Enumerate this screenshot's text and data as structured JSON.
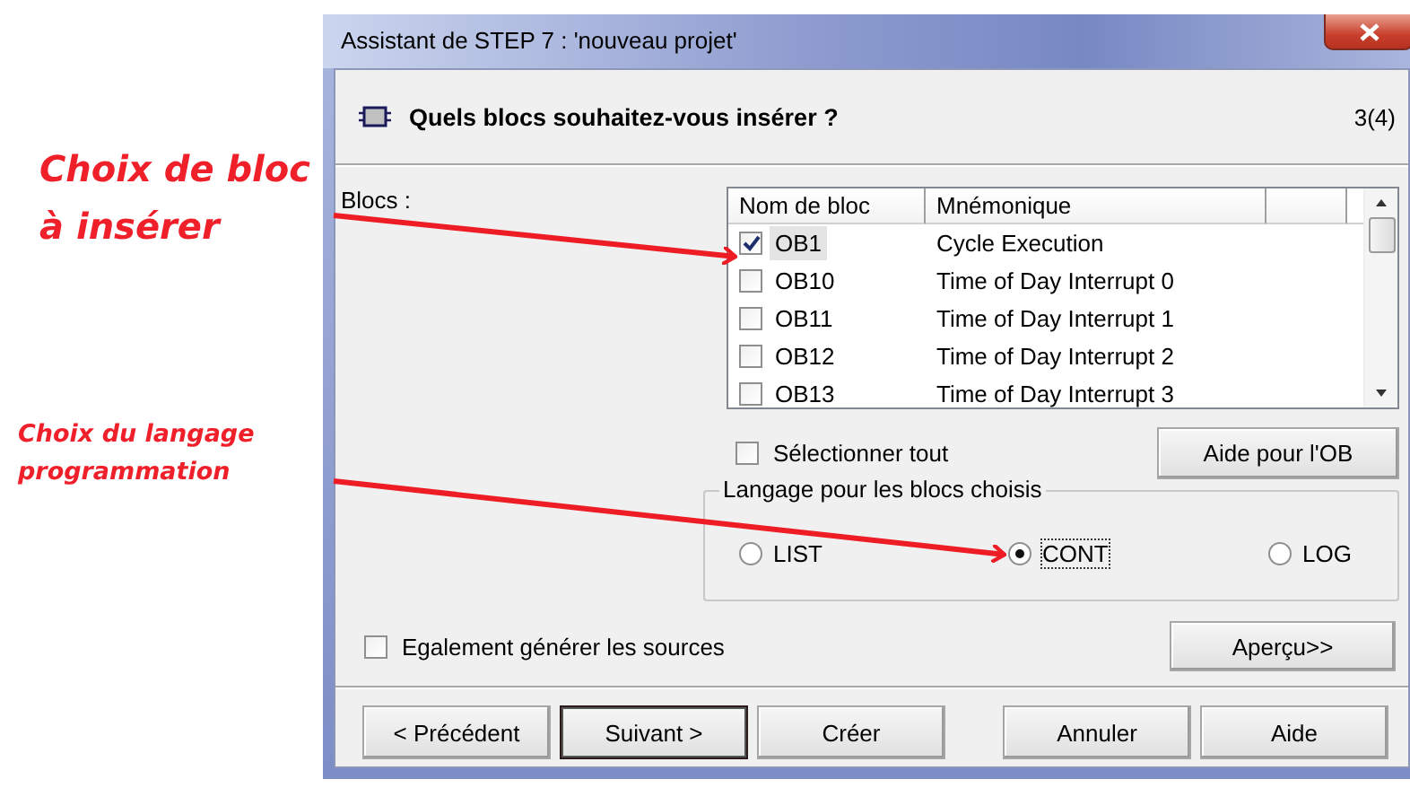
{
  "annotations": [
    {
      "text": "Choix de bloc\nà insérer",
      "kind": "heading"
    },
    {
      "text": "Choix du langage\nprogrammation",
      "kind": "note"
    }
  ],
  "window": {
    "title": "Assistant de STEP 7 : 'nouveau projet'"
  },
  "header": {
    "title": "Quels blocs souhaitez-vous insérer ?",
    "step": "3(4)"
  },
  "blocks_label": "Blocs :",
  "table": {
    "columns": [
      "Nom de bloc",
      "Mnémonique"
    ],
    "rows": [
      {
        "name": "OB1",
        "mnemonic": "Cycle Execution",
        "checked": true,
        "selected": true
      },
      {
        "name": "OB10",
        "mnemonic": "Time of Day Interrupt 0",
        "checked": false,
        "selected": false
      },
      {
        "name": "OB11",
        "mnemonic": "Time of Day Interrupt 1",
        "checked": false,
        "selected": false
      },
      {
        "name": "OB12",
        "mnemonic": "Time of Day Interrupt 2",
        "checked": false,
        "selected": false
      },
      {
        "name": "OB13",
        "mnemonic": "Time of Day Interrupt 3",
        "checked": false,
        "selected": false
      }
    ]
  },
  "select_all": {
    "label": "Sélectionner tout",
    "checked": false
  },
  "help_button": "Aide pour l'OB",
  "language_group": {
    "legend": "Langage pour les blocs choisis",
    "options": [
      {
        "label": "LIST",
        "selected": false
      },
      {
        "label": "CONT",
        "selected": true
      },
      {
        "label": "LOG",
        "selected": false
      }
    ]
  },
  "generate_sources": {
    "label": "Egalement générer les sources",
    "checked": false
  },
  "preview_button": "Aperçu>>",
  "buttons": [
    {
      "label": "< Précédent",
      "default": false
    },
    {
      "label": "Suivant >",
      "default": true
    },
    {
      "label": "Créer",
      "default": false
    },
    {
      "label": "Annuler",
      "default": false
    },
    {
      "label": "Aide",
      "default": false
    }
  ]
}
